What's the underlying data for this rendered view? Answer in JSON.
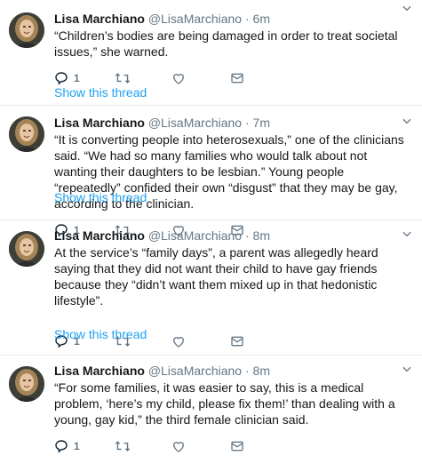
{
  "tweets": [
    {
      "name": "Lisa Marchiano",
      "handle": "@LisaMarchiano",
      "dot": "·",
      "time": "6m",
      "text": "“Children’s bodies are being damaged in order to treat societal issues,” she warned.",
      "reply_count": "1",
      "thread_label": "Show this thread"
    },
    {
      "name": "Lisa Marchiano",
      "handle": "@LisaMarchiano",
      "dot": "·",
      "time": "7m",
      "text": "“It is converting people into heterosexuals,” one of the clinicians said. “We had so many families who would talk about not wanting their daughters to be lesbian.” Young people “repeatedly” confided their own “disgust” that they may be gay, according to the clinician.",
      "reply_count": "1",
      "thread_label": "Show this thread"
    },
    {
      "name": "Lisa Marchiano",
      "handle": "@LisaMarchiano",
      "dot": "·",
      "time": "8m",
      "text": "At the service’s “family days”, a parent was allegedly heard saying that they did not want their child to have gay friends because they “didn’t want them mixed up in that hedonistic lifestyle”.",
      "reply_count": "1",
      "thread_label": "Show this thread"
    },
    {
      "name": "Lisa Marchiano",
      "handle": "@LisaMarchiano",
      "dot": "·",
      "time": "8m",
      "text": "“For some families, it was easier to say, this is a medical problem, ‘here’s my child, please fix them!’ than dealing with a young, gay kid,” the third female clinician said.",
      "reply_count": "1"
    }
  ],
  "icons": {
    "reply": "reply-icon",
    "retweet": "retweet-icon",
    "like": "heart-icon",
    "dm": "envelope-icon",
    "more": "chevron-down-icon"
  },
  "colors": {
    "link": "#1da1f2",
    "muted": "#657786",
    "text": "#14171a",
    "divider": "#e6ecf0"
  }
}
